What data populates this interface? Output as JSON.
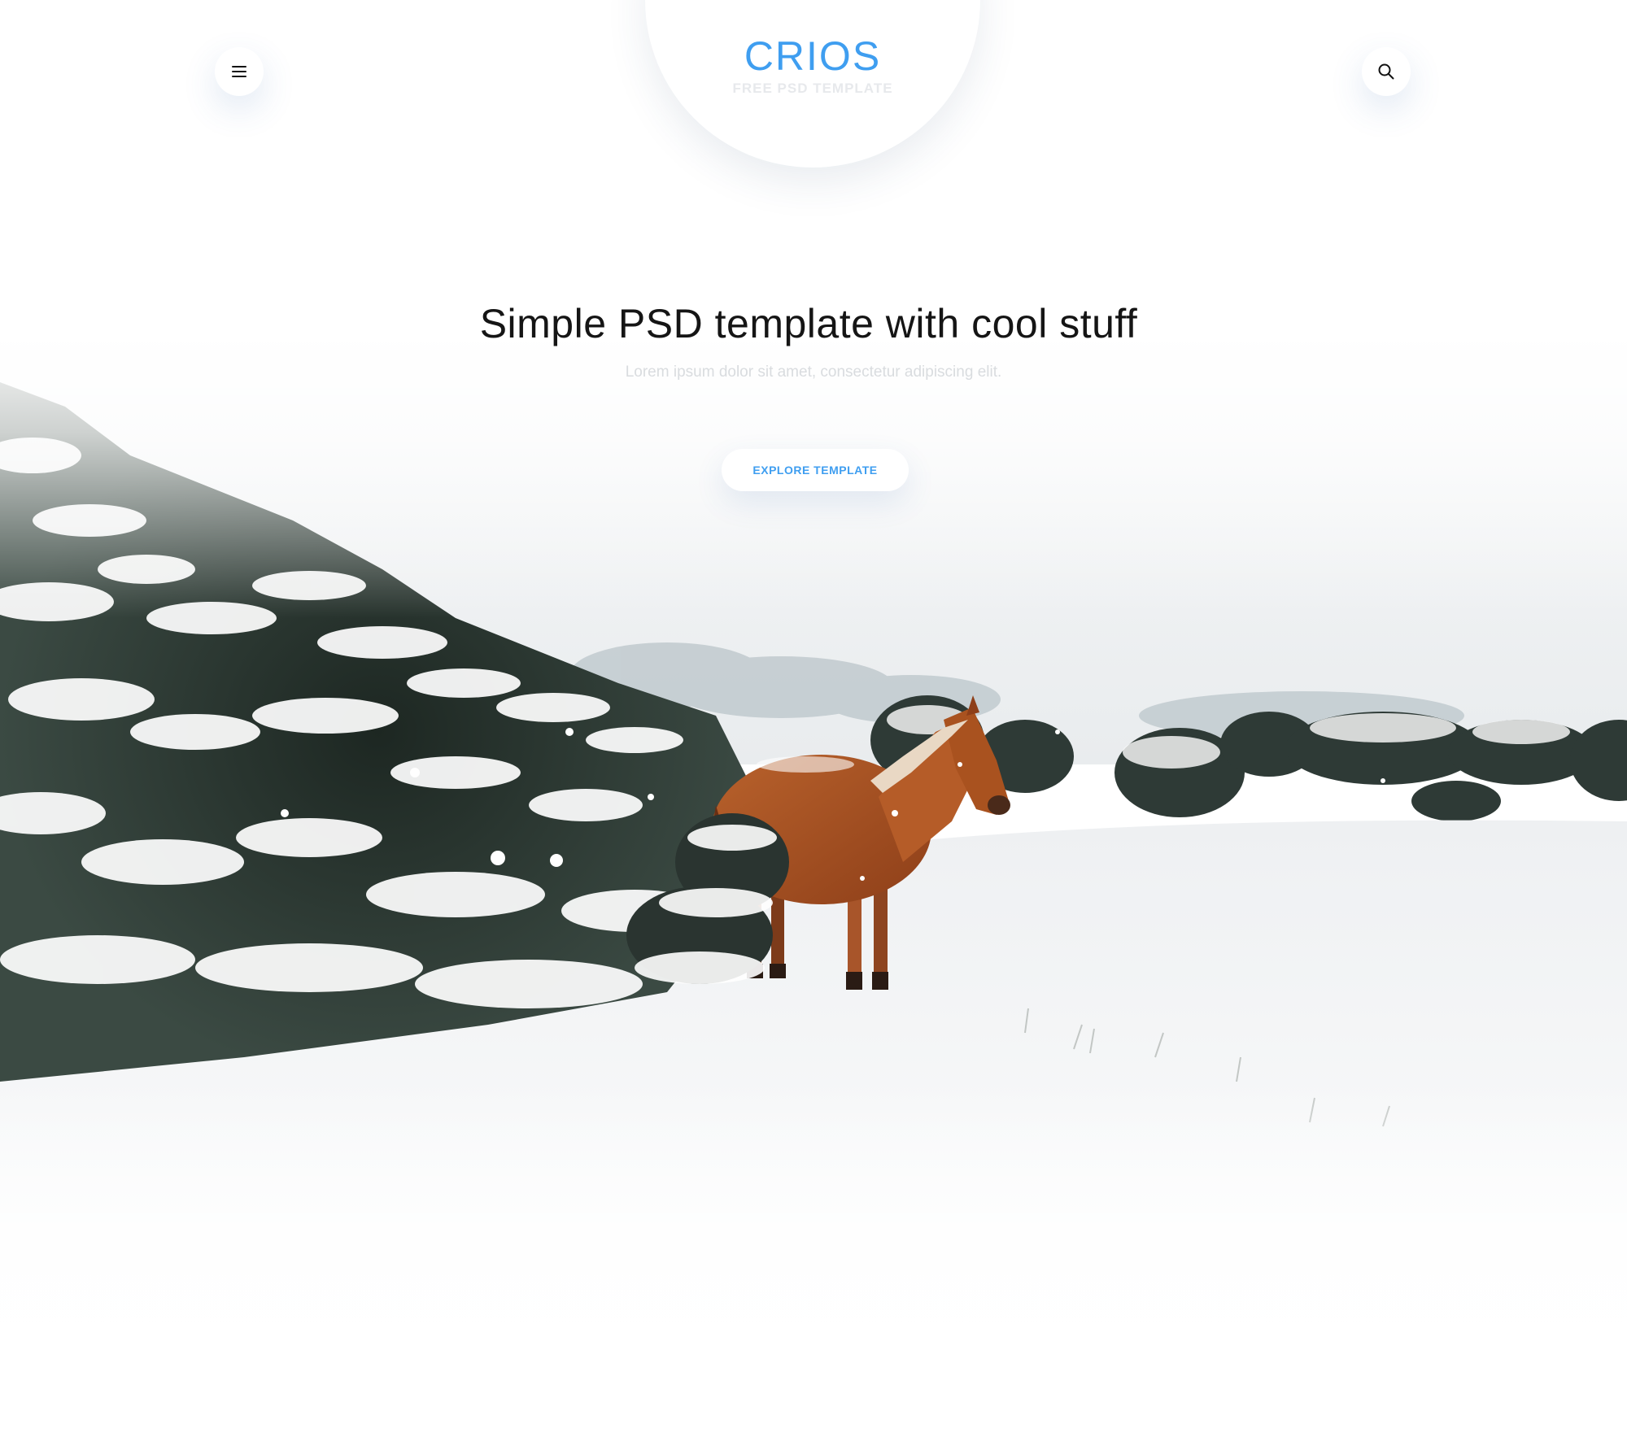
{
  "header": {
    "logo_title": "CRIOS",
    "logo_subtitle": "FREE PSD TEMPLATE",
    "menu_icon": "hamburger-menu-icon",
    "search_icon": "search-icon"
  },
  "hero": {
    "title": "Simple PSD template with cool stuff",
    "subtitle": "Lorem ipsum dolor sit amet, consectetur adipiscing elit.",
    "cta_label": "EXPLORE TEMPLATE",
    "background_image": "snowy-landscape-with-brown-horse"
  },
  "colors": {
    "accent": "#3f9ef0",
    "title": "#151515",
    "subtitle": "#d9dcdf",
    "background": "#ffffff"
  }
}
